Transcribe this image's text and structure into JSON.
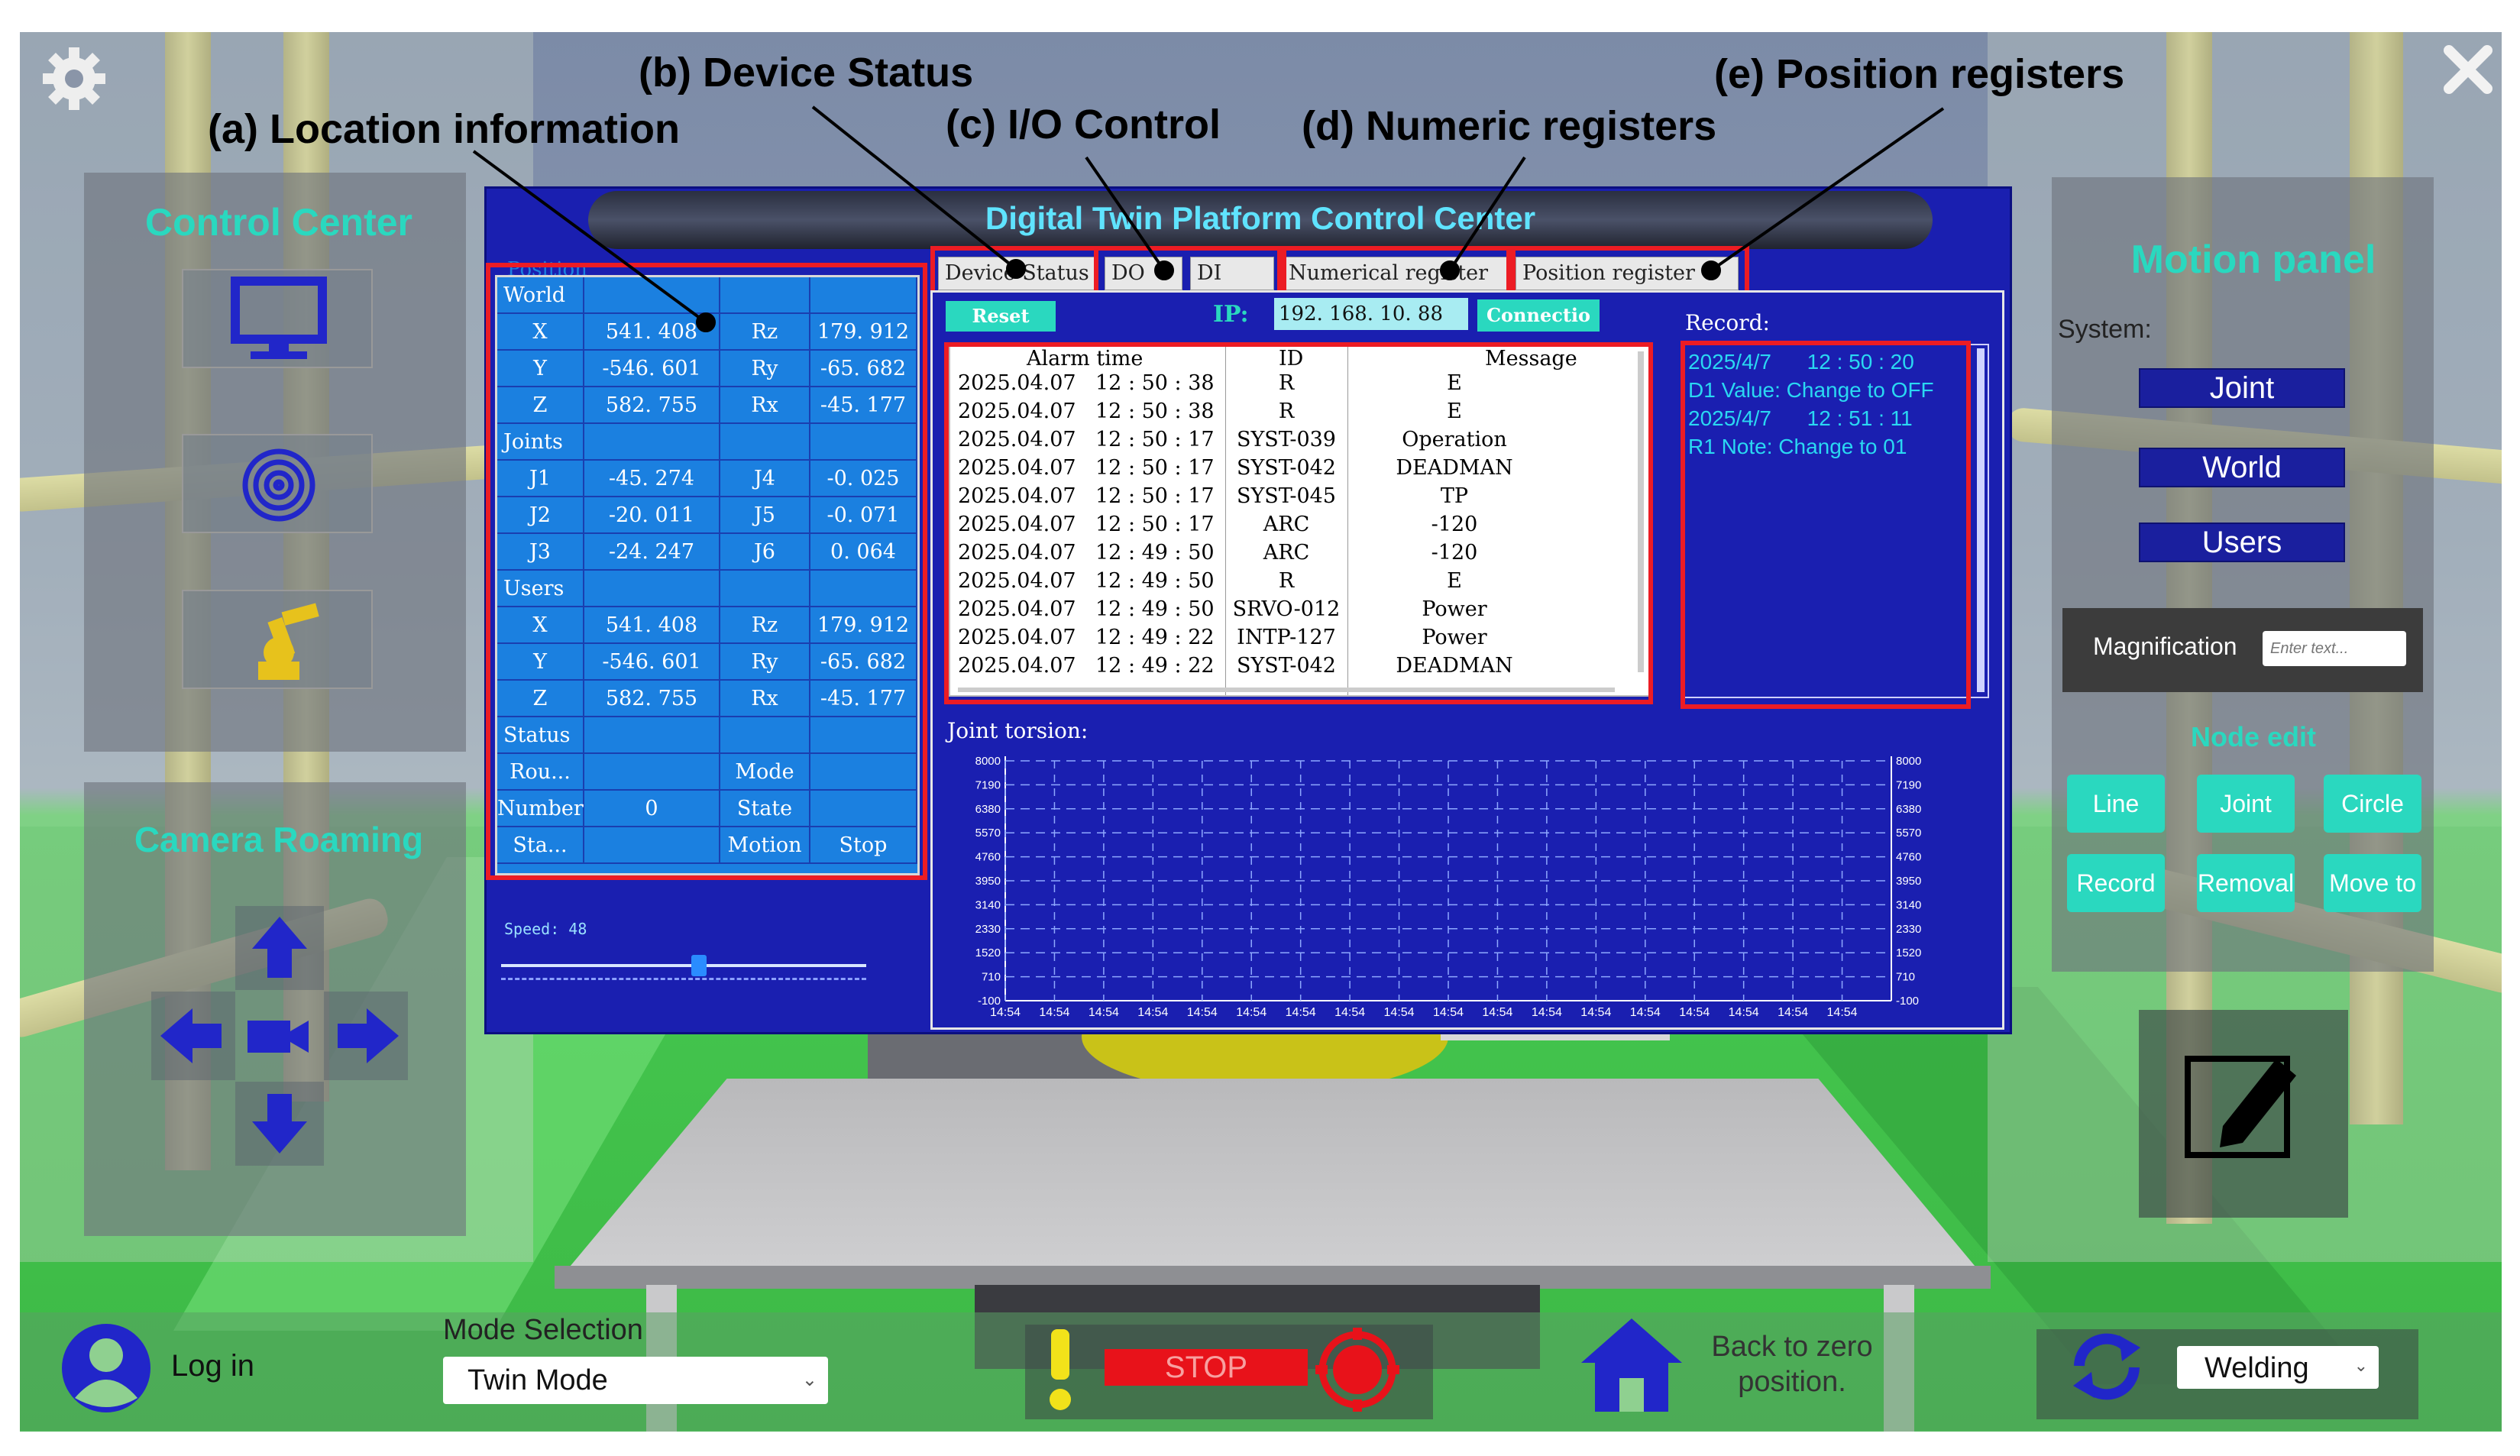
{
  "annotations": {
    "a": "(a) Location information",
    "b": "(b) Device Status",
    "c": "(c) I/O Control",
    "d": "(d) Numeric registers",
    "e": "(e) Position registers"
  },
  "control_center": {
    "title": "Control Center"
  },
  "camera_roaming": {
    "title": "Camera Roaming"
  },
  "panel": {
    "title": "Digital Twin Platform Control Center",
    "position_tab": "Position",
    "tabs": [
      "Device Status",
      "DO",
      "DI",
      "Numerical register",
      "Position register"
    ],
    "reset": "Reset",
    "ip_label": "IP:",
    "ip_value": "192. 168. 10. 88",
    "connect": "Connectio",
    "record_label": "Record:",
    "speed": "Speed: 48",
    "speed_value": 48,
    "torsion_label": "Joint torsion:"
  },
  "location": {
    "rows": [
      [
        "World",
        "",
        "",
        ""
      ],
      [
        "X",
        "541. 408",
        "Rz",
        "179. 912"
      ],
      [
        "Y",
        "-546. 601",
        "Ry",
        "-65. 682"
      ],
      [
        "Z",
        "582. 755",
        "Rx",
        "-45. 177"
      ],
      [
        "Joints",
        "",
        "",
        ""
      ],
      [
        "J1",
        "-45. 274",
        "J4",
        "-0. 025"
      ],
      [
        "J2",
        "-20. 011",
        "J5",
        "-0. 071"
      ],
      [
        "J3",
        "-24. 247",
        "J6",
        "0. 064"
      ],
      [
        "Users",
        "",
        "",
        ""
      ],
      [
        "X",
        "541. 408",
        "Rz",
        "179. 912"
      ],
      [
        "Y",
        "-546. 601",
        "Ry",
        "-65. 682"
      ],
      [
        "Z",
        "582. 755",
        "Rx",
        "-45. 177"
      ],
      [
        "Status",
        "",
        "",
        ""
      ],
      [
        "Rou...",
        "",
        "Mode",
        ""
      ],
      [
        "Number",
        "0",
        "State",
        ""
      ],
      [
        "Sta...",
        "",
        "Motion",
        "Stop"
      ]
    ]
  },
  "alarm": {
    "headers": [
      "Alarm time",
      "ID",
      "Message"
    ],
    "rows": [
      [
        "2025.04.07",
        "12 : 50 : 38",
        "R",
        "E"
      ],
      [
        "2025.04.07",
        "12 : 50 : 38",
        "R",
        "E"
      ],
      [
        "2025.04.07",
        "12 : 50 : 17",
        "SYST-039",
        "Operation"
      ],
      [
        "2025.04.07",
        "12 : 50 : 17",
        "SYST-042",
        "DEADMAN"
      ],
      [
        "2025.04.07",
        "12 : 50 : 17",
        "SYST-045",
        "TP"
      ],
      [
        "2025.04.07",
        "12 : 50 : 17",
        "ARC",
        "-120"
      ],
      [
        "2025.04.07",
        "12 : 49 : 50",
        "ARC",
        "-120"
      ],
      [
        "2025.04.07",
        "12 : 49 : 50",
        "R",
        "E"
      ],
      [
        "2025.04.07",
        "12 : 49 : 50",
        "SRVO-012",
        "Power"
      ],
      [
        "2025.04.07",
        "12 : 49 : 22",
        "INTP-127",
        "Power"
      ],
      [
        "2025.04.07",
        "12 : 49 : 22",
        "SYST-042",
        "DEADMAN"
      ]
    ]
  },
  "record": {
    "lines": [
      "2025/4/7      12 : 50 : 20",
      "D1 Value: Change to OFF",
      "2025/4/7      12 : 51 : 11",
      "R1 Note: Change to 01"
    ]
  },
  "chart": {
    "y_ticks": [
      "8000",
      "7190",
      "6380",
      "5570",
      "4760",
      "3950",
      "3140",
      "2330",
      "1520",
      "710",
      "-100"
    ],
    "x_tick": "14:54",
    "x_count": 18
  },
  "motion": {
    "title": "Motion panel",
    "system": "System:",
    "buttons": [
      "Joint",
      "World",
      "Users"
    ],
    "magnification": "Magnification",
    "mag_placeholder": "Enter text...",
    "node_edit": "Node edit",
    "node_buttons": [
      "Line",
      "Joint",
      "Circle",
      "Record",
      "Removal",
      "Move to"
    ]
  },
  "bottom": {
    "login": "Log in",
    "mode_label": "Mode Selection",
    "mode_value": "Twin Mode",
    "stop": "STOP",
    "back_zero": "Back to zero position.",
    "welding": "Welding"
  },
  "colors": {
    "panel_blue": "#1a1fb0",
    "cell_blue": "#1b80e0",
    "teal": "#2ad8bf",
    "stop_red": "#e8121a"
  }
}
